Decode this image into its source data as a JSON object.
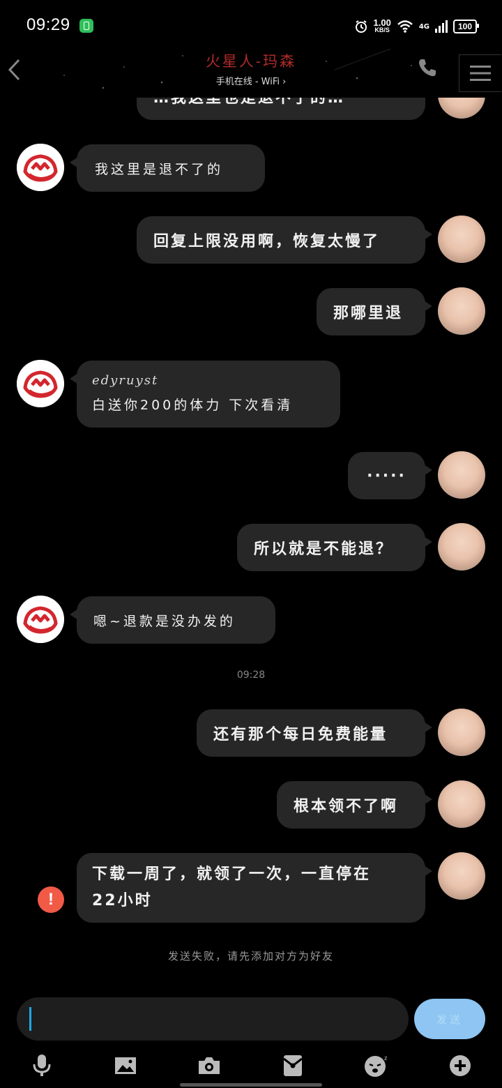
{
  "status": {
    "time": "09:29",
    "speed_value": "1.00",
    "speed_unit": "KB/S",
    "network": "4G",
    "battery": "100"
  },
  "header": {
    "title": "火星人-玛森",
    "subtitle": "手机在线 - WiFi",
    "icons": [
      "back-chevron-icon",
      "phone-icon",
      "menu-icon"
    ]
  },
  "messages": [
    {
      "side": "out",
      "text": "…我这里也是退不了的…"
    },
    {
      "side": "in",
      "text": "我这里是退不了的"
    },
    {
      "side": "out",
      "text": "回复上限没用啊，恢复太慢了"
    },
    {
      "side": "out",
      "text": "那哪里退"
    },
    {
      "side": "in",
      "line1": "edyruyst",
      "line2": "白送你200的体力  下次看清"
    },
    {
      "side": "out",
      "text": "·····"
    },
    {
      "side": "out",
      "text": "所以就是不能退？"
    },
    {
      "side": "in",
      "text": "嗯~退款是没办发的"
    },
    {
      "side": "out",
      "text": "还有那个每日免费能量"
    },
    {
      "side": "out",
      "text": "根本领不了啊"
    },
    {
      "side": "out",
      "line1": "下载一周了，就领了一次，一直停在",
      "line2": "22小时",
      "failed": true
    }
  ],
  "timestamp": "09:28",
  "fail_notice": "发送失败，请先添加对方为好友",
  "composer": {
    "value": "",
    "send_label": "发送"
  },
  "toolbar": [
    "mic-icon",
    "image-icon",
    "camera-icon",
    "red-packet-icon",
    "emoji-icon",
    "plus-icon"
  ],
  "colors": {
    "background": "#000000",
    "bubble": "#272727",
    "title": "#b02a2a",
    "send_button": "#8ec5f2",
    "fail": "#f15a47",
    "cursor": "#1fa7e8"
  }
}
